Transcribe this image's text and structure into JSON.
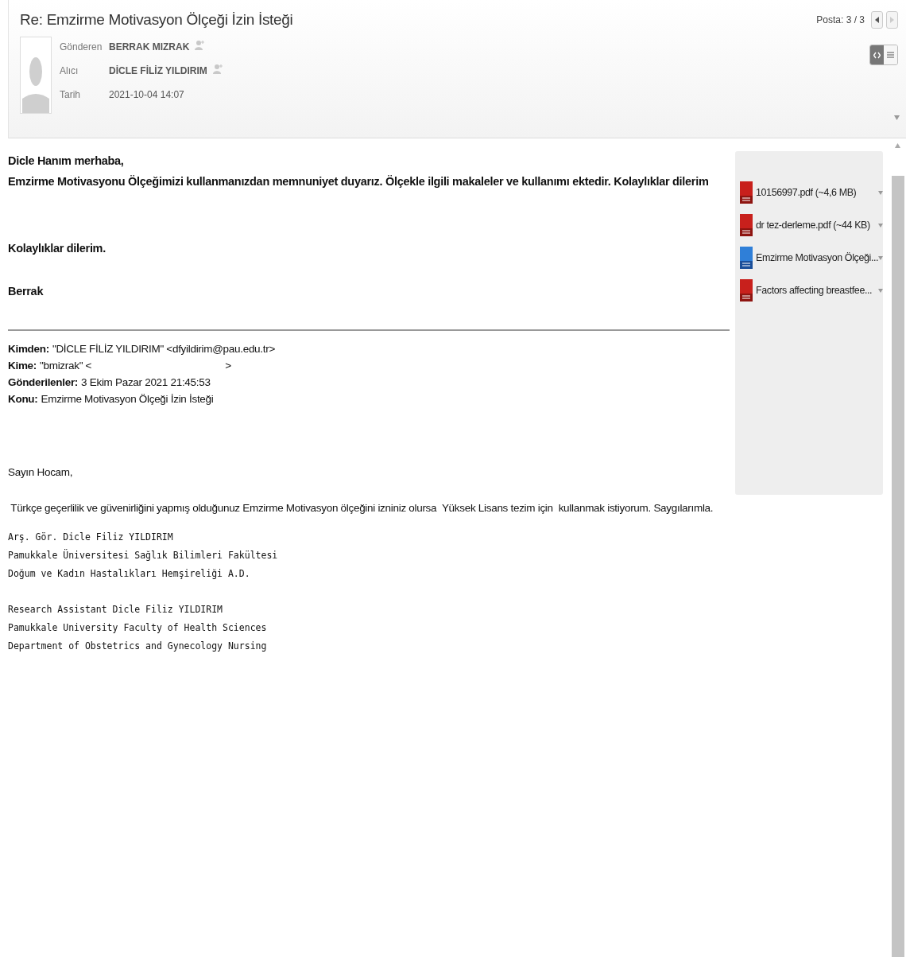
{
  "header": {
    "subject": "Re: Emzirme Motivasyon Ölçeği İzin İsteği",
    "counter": "Posta: 3 / 3",
    "fields": [
      {
        "label": "Gönderen",
        "value": "BERRAK MIZRAK",
        "add_contact": true
      },
      {
        "label": "Alıcı",
        "value": "DİCLE FİLİZ YILDIRIM",
        "add_contact": true
      },
      {
        "label": "Tarih",
        "value": "2021-10-04 14:07",
        "add_contact": false
      }
    ],
    "view_toggle": [
      {
        "kind": "html",
        "selected": true
      },
      {
        "kind": "text",
        "selected": false
      }
    ]
  },
  "reply": {
    "greeting": "Dicle Hanım merhaba,",
    "message": "Emzirme Motivasyonu Ölçeğimizi kullanmanızdan memnuniyet duyarız. Ölçekle ilgili makaleler ve kullanımı ektedir. Kolaylıklar dilerim",
    "closing": "Kolaylıklar dilerim.",
    "signature": "Berrak"
  },
  "quoted_header": [
    {
      "label": "Kimden:",
      "value": "\"DİCLE FİLİZ YILDIRIM\" <dfyildirim@pau.edu.tr>"
    },
    {
      "label": "Kime:",
      "value": "\"bmizrak\" <",
      "after": ">"
    },
    {
      "label": "Gönderilenler:",
      "value": "3 Ekim Pazar 2021 21:45:53"
    },
    {
      "label": "Konu:",
      "value": "Emzirme Motivasyon Ölçeği İzin İsteği"
    }
  ],
  "quoted_body": {
    "greeting": "Sayın Hocam,",
    "message": " Türkçe geçerlilik ve güvenirliğini yapmış olduğunuz Emzirme Motivasyon ölçeğini izniniz olursa  Yüksek Lisans tezim için  kullanmak istiyorum. Saygılarımla.",
    "signature_blocks": [
      [
        "Arş. Gör. Dicle Filiz YILDIRIM",
        "Pamukkale Üniversitesi Sağlık Bilimleri Fakültesi",
        "Doğum ve Kadın Hastalıkları Hemşireliği A.D."
      ],
      [
        "Research Assistant Dicle Filiz YILDIRIM",
        "Pamukkale University Faculty of Health Sciences",
        "Department of Obstetrics and Gynecology Nursing"
      ]
    ]
  },
  "attachments": [
    {
      "kind": "pdf",
      "name": "10156997.pdf (~4,6 MB)"
    },
    {
      "kind": "pdf",
      "name": "dr tez-derleme.pdf (~44 KB)"
    },
    {
      "kind": "doc",
      "name": "Emzirme Motivasyon Ölçeği..."
    },
    {
      "kind": "pdf",
      "name": "Factors affecting breastfee..."
    }
  ]
}
